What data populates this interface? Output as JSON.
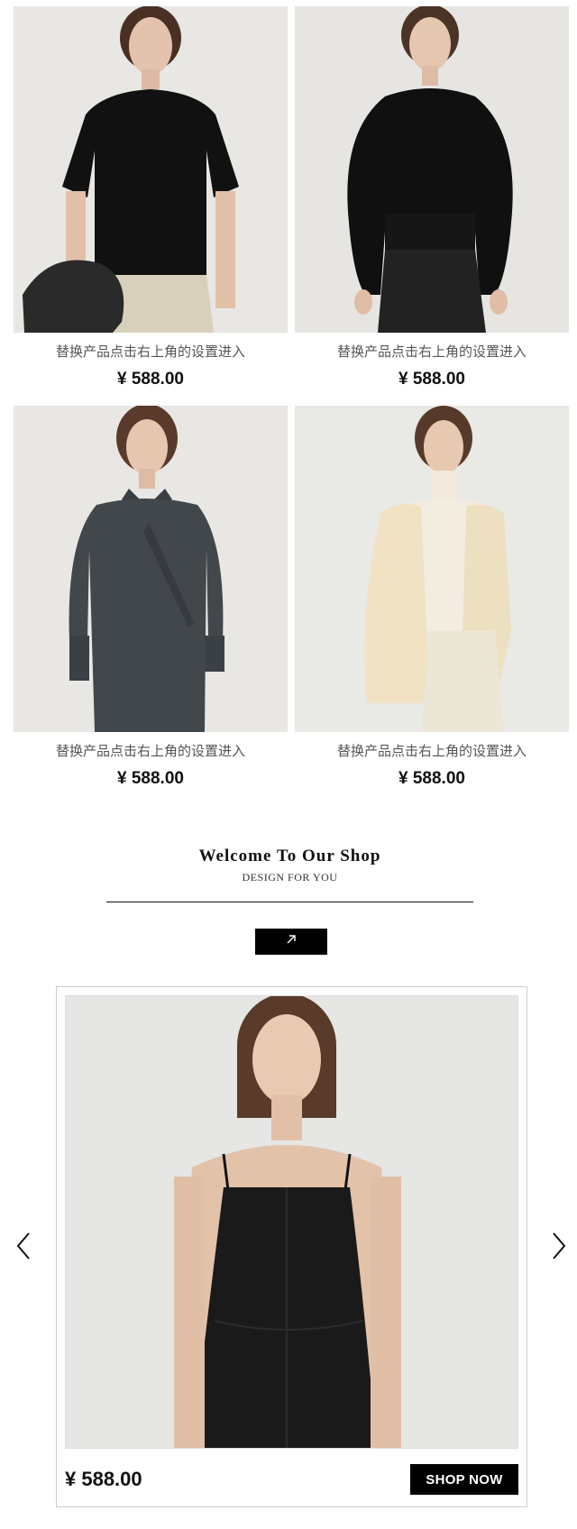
{
  "products": [
    {
      "name": "替换产品点击右上角的设置进入",
      "price": "¥ 588.00",
      "image": "model-black-tshirt"
    },
    {
      "name": "替换产品点击右上角的设置进入",
      "price": "¥ 588.00",
      "image": "model-black-sweater"
    },
    {
      "name": "替换产品点击右上角的设置进入",
      "price": "¥ 588.00",
      "image": "model-grey-wrap-dress"
    },
    {
      "name": "替换产品点击右上角的设置进入",
      "price": "¥ 588.00",
      "image": "model-cream-cardigan"
    }
  ],
  "welcome": {
    "title": "Welcome To Our Shop",
    "subtitle": "DESIGN FOR YOU",
    "button_icon": "arrow-up-right-icon"
  },
  "carousel": {
    "price": "¥ 588.00",
    "cta": "SHOP NOW",
    "image": "model-black-slip-dress",
    "prev_icon": "chevron-left-icon",
    "next_icon": "chevron-right-icon"
  },
  "colors": {
    "accent": "#000000",
    "background": "#ffffff",
    "photo_bg": "#e7e7e5"
  }
}
